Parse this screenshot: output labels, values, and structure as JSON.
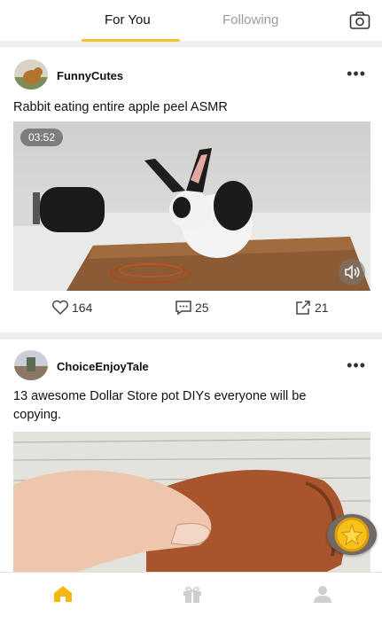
{
  "header": {
    "tabs": [
      {
        "label": "For You",
        "active": true
      },
      {
        "label": "Following",
        "active": false
      }
    ],
    "camera_icon": "camera-icon",
    "accent_color": "#f6c12d"
  },
  "feed": [
    {
      "username": "FunnyCutes",
      "caption": "Rabbit eating entire apple peel ASMR",
      "duration": "03:52",
      "likes": "164",
      "comments": "25",
      "shares": "21"
    },
    {
      "username": "ChoiceEnjoyTale",
      "caption": "13 awesome Dollar Store pot DIYs everyone will be copying."
    }
  ],
  "bottom_nav": [
    {
      "icon": "home-icon",
      "active": true
    },
    {
      "icon": "gift-icon",
      "active": false
    },
    {
      "icon": "profile-icon",
      "active": false
    }
  ],
  "floating": {
    "icon": "star-coin-icon"
  }
}
